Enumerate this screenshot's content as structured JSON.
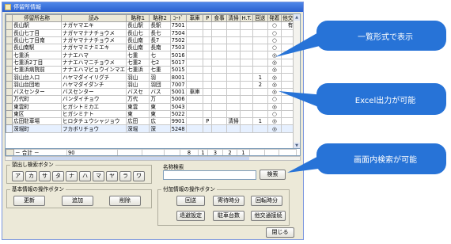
{
  "window": {
    "title": "停留所情報"
  },
  "columns": [
    "停留所名称",
    "読み",
    "略称1",
    "略称2",
    "ｺｰﾄﾞ",
    "車庫",
    "P",
    "食事",
    "清掃",
    "H.T.",
    "回送",
    "発着",
    "他交通"
  ],
  "rows": [
    [
      "長山駅",
      "ナガヤマエキ",
      "長山駅",
      "長駅",
      "7501",
      "",
      "",
      "",
      "",
      "",
      "",
      "○",
      "有"
    ],
    [
      "長山七丁目",
      "ナガヤマナナチョウメ",
      "長山七",
      "長七",
      "7504",
      "",
      "",
      "",
      "",
      "",
      "",
      "○",
      ""
    ],
    [
      "長山七丁目南",
      "ナガヤマナナチョウメ",
      "長山南",
      "長7",
      "7502",
      "",
      "",
      "",
      "",
      "",
      "",
      "○",
      ""
    ],
    [
      "長山南駅",
      "ナガヤマミナミエキ",
      "長山南",
      "長南",
      "7503",
      "",
      "",
      "",
      "",
      "",
      "",
      "○",
      ""
    ],
    [
      "七重浜",
      "ナナエハマ",
      "七重",
      "七",
      "5016",
      "",
      "",
      "",
      "",
      "",
      "",
      "◎",
      ""
    ],
    [
      "七重浜2丁目",
      "ナナエハマニチョウメ",
      "七重2",
      "七2",
      "5017",
      "",
      "",
      "",
      "",
      "",
      "",
      "◎",
      ""
    ],
    [
      "七重浜病院前",
      "ナナエハマビョウインマエ",
      "七重浜",
      "七重",
      "5015",
      "",
      "",
      "",
      "",
      "",
      "",
      "◎",
      ""
    ],
    [
      "羽山台入口",
      "ハヤマダイイリグチ",
      "羽山",
      "羽",
      "8001",
      "",
      "",
      "",
      "",
      "",
      "1",
      "◎",
      ""
    ],
    [
      "羽山台団地",
      "ハヤマダイダンチ",
      "羽山",
      "羽団",
      "7007",
      "",
      "",
      "",
      "",
      "",
      "2",
      "◎",
      ""
    ],
    [
      "バスセンター",
      "バスセンター",
      "バスセ",
      "バス",
      "5001",
      "車庫",
      "",
      "",
      "",
      "",
      "",
      "◎",
      ""
    ],
    [
      "万代町",
      "バンダイチョウ",
      "万代",
      "万",
      "5006",
      "",
      "",
      "",
      "",
      "",
      "",
      "○",
      ""
    ],
    [
      "東雲町",
      "ヒガシトミカエ",
      "東雲",
      "東",
      "5043",
      "",
      "",
      "",
      "",
      "",
      "",
      "◎",
      ""
    ],
    [
      "東区",
      "ヒガシミナト",
      "東",
      "東",
      "5022",
      "",
      "",
      "",
      "",
      "",
      "",
      "○",
      ""
    ],
    [
      "広田駐車場",
      "ヒロタチュウシャジョウ",
      "広田",
      "広",
      "9901",
      "",
      "P",
      "",
      "清掃",
      "",
      "1",
      "◎",
      ""
    ],
    [
      "深堀町",
      "フカボリチョウ",
      "深堀",
      "深",
      "5248",
      "",
      "",
      "",
      "",
      "",
      "",
      "◎",
      ""
    ]
  ],
  "totals": {
    "label": "－ 合計 －",
    "count": "90",
    "depot": "8",
    "parking": "1",
    "meal": "3",
    "cleaning": "2",
    "ht": "1",
    "deadhead": ""
  },
  "kana_search": {
    "label": "頭出し検索ボタン",
    "buttons": [
      "ア",
      "カ",
      "サ",
      "タ",
      "ナ",
      "ハ",
      "マ",
      "ヤ",
      "ラ",
      "ワ"
    ]
  },
  "name_search": {
    "label": "名称検索",
    "value": "",
    "button": "検索"
  },
  "basic_ops": {
    "label": "基本情報の操作ボタン",
    "update": "更新",
    "add": "追加",
    "delete": "削除"
  },
  "extra_ops": {
    "label": "付加情報の操作ボタン",
    "deadhead": "回送",
    "pre_wait": "寄待時分",
    "transfer": "回転時分",
    "depot_setting": "退避設定",
    "parking_count": "駐車台数",
    "other_transit": "他交通接続"
  },
  "close_button": "閉じる",
  "callouts": [
    "一覧形式で表示",
    "Excel出力が可能",
    "画面内検索が可能"
  ],
  "colors": {
    "callout": "#2773d7",
    "titlebar": "#2a5fcf",
    "window_bg": "#ece9d8"
  }
}
